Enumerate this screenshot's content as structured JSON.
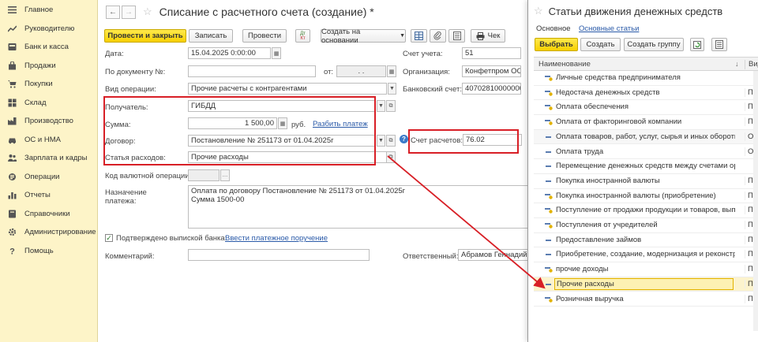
{
  "sidebar": {
    "items": [
      {
        "label": "Главное",
        "icon": "menu-icon"
      },
      {
        "label": "Руководителю",
        "icon": "chart-trend-icon"
      },
      {
        "label": "Банк и касса",
        "icon": "bank-icon"
      },
      {
        "label": "Продажи",
        "icon": "shopping-bag-icon"
      },
      {
        "label": "Покупки",
        "icon": "cart-icon"
      },
      {
        "label": "Склад",
        "icon": "warehouse-icon"
      },
      {
        "label": "Производство",
        "icon": "factory-icon"
      },
      {
        "label": "ОС и НМА",
        "icon": "car-icon"
      },
      {
        "label": "Зарплата и кадры",
        "icon": "people-icon"
      },
      {
        "label": "Операции",
        "icon": "operations-icon"
      },
      {
        "label": "Отчеты",
        "icon": "bar-chart-icon"
      },
      {
        "label": "Справочники",
        "icon": "book-icon"
      },
      {
        "label": "Администрирование",
        "icon": "gear-icon"
      },
      {
        "label": "Помощь",
        "icon": "help-icon"
      }
    ]
  },
  "document": {
    "title": "Списание с расчетного счета (создание) *",
    "toolbar": {
      "post_close": "Провести и закрыть",
      "save": "Записать",
      "post": "Провести",
      "dtkt_top": "Дт",
      "dtkt_bottom": "Кт",
      "create_based": "Создать на основании",
      "check": "Чек"
    },
    "fields": {
      "date_label": "Дата:",
      "date_value": "15.04.2025  0:00:00",
      "account_label": "Счет учета:",
      "account_value": "51",
      "doc_num_label": "По документу №:",
      "from_label": "от:",
      "from_value": ".  .",
      "org_label": "Организация:",
      "org_value": "Конфетпром ООО",
      "op_type_label": "Вид операции:",
      "op_type_value": "Прочие расчеты с контрагентами",
      "bank_acc_label": "Банковский счет:",
      "bank_acc_value": "40702810000000000000",
      "recipient_label": "Получатель:",
      "recipient_value": "ГИБДД",
      "amount_label": "Сумма:",
      "amount_value": "1 500,00",
      "currency": "руб.",
      "split_link": "Разбить платеж",
      "contract_label": "Договор:",
      "contract_value": "Постановление № 251173 от 01.04.2025г",
      "settle_acc_label": "Счет расчетов:",
      "settle_acc_value": "76.02",
      "expense_item_label": "Статья расходов:",
      "expense_item_value": "Прочие расходы",
      "currency_op_label": "Код валютной операции:",
      "purpose_label_1": "Назначение",
      "purpose_label_2": "платежа:",
      "purpose_line_1": "Оплата по договору Постановление № 251173 от 01.04.2025г",
      "purpose_line_2": "Сумма 1500-00",
      "confirmed_label": "Подтверждено выпиской банка:",
      "enter_order_link": "Ввести платежное поручение",
      "comment_label": "Комментарий:",
      "responsible_label": "Ответственный:",
      "responsible_value": "Абрамов Геннадий С"
    }
  },
  "dialog": {
    "title": "Статьи движения денежных средств",
    "tabs": [
      "Основное",
      "Основные статьи"
    ],
    "buttons": {
      "select": "Выбрать",
      "create": "Создать",
      "create_group": "Создать группу"
    },
    "columns": {
      "name": "Наименование",
      "sort": "↓",
      "type": "Вид"
    },
    "rows": [
      {
        "name": "Личные средства предпринимателя",
        "type": "",
        "icon": "in"
      },
      {
        "name": "Недостача денежных средств",
        "type": "Прочие",
        "icon": "in"
      },
      {
        "name": "Оплата обеспечения",
        "type": "Прочие",
        "icon": "in"
      },
      {
        "name": "Оплата от факторинговой компании",
        "type": "Поступ",
        "icon": "in"
      },
      {
        "name": "Оплата товаров, работ, услуг, сырья и иных оборотн...",
        "type": "Оплата",
        "icon": "out"
      },
      {
        "name": "Оплата труда",
        "type": "Оплата",
        "icon": "out"
      },
      {
        "name": "Перемещение денежных средств между счетами орг...",
        "type": "",
        "icon": "out"
      },
      {
        "name": "Покупка иностранной валюты",
        "type": "Прочие",
        "icon": "out"
      },
      {
        "name": "Покупка иностранной валюты (приобретение)",
        "type": "Прочие",
        "icon": "in"
      },
      {
        "name": "Поступление от продажи продукции и товаров, выпо...",
        "type": "Поступ",
        "icon": "in"
      },
      {
        "name": "Поступления от учредителей",
        "type": "Прочие",
        "icon": "in"
      },
      {
        "name": "Предоставление займов",
        "type": "Прочие",
        "icon": "out"
      },
      {
        "name": "Приобретение, создание, модернизация и реконстр...",
        "type": "Прочие",
        "icon": "out"
      },
      {
        "name": "прочие доходы",
        "type": "Прочие",
        "icon": "in"
      },
      {
        "name": "Прочие расходы",
        "type": "Прочие",
        "icon": "out"
      },
      {
        "name": "Розничная выручка",
        "type": "Поступ",
        "icon": "in"
      }
    ]
  },
  "colors": {
    "sidebar_bg": "#fdf4c8",
    "primary_button": "#f7d000",
    "highlight_red": "#d81f26",
    "link": "#2a5aa8",
    "selected_row": "#fdf1b3"
  }
}
